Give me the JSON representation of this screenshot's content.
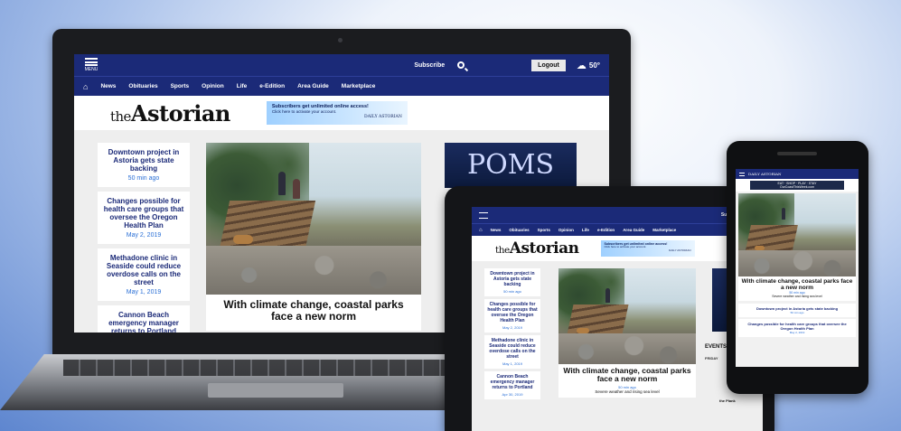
{
  "site": {
    "menu_label": "MENU",
    "subscribe": "Subscribe",
    "logout": "Logout",
    "weather_temp": "50°",
    "nav": [
      "News",
      "Obituaries",
      "Sports",
      "Opinion",
      "Life",
      "e-Edition",
      "Area Guide",
      "Marketplace"
    ],
    "logo_the": "the",
    "logo_name": "Astorian",
    "promo_line1": "Subscribers get unlimited online access!",
    "promo_line2": "Click here to activate your account.",
    "promo_brand": "DAILY ASTORIAN",
    "sidebar": [
      {
        "title": "Downtown project in Astoria gets state backing",
        "time": "50 min ago"
      },
      {
        "title": "Changes possible for health care groups that oversee the Oregon Health Plan",
        "time": "May 2, 2019"
      },
      {
        "title": "Methadone clinic in Seaside could reduce overdose calls on the street",
        "time": "May 1, 2019"
      },
      {
        "title": "Cannon Beach emergency manager returns to Portland",
        "time": "Apr 30, 2019"
      }
    ],
    "headline": "With climate change, coastal parks face a new norm",
    "headline_time": "50 min ago",
    "headline_sub": "Severe weather and rising sea level",
    "poms": "POMS",
    "events_label": "EVENTS",
    "friday": "FRIDAY",
    "phone_logo": "DAILY ASTORIAN",
    "phone_ad": "EAT · SHOP · PLAY · STAY",
    "phone_ad_sub": "OurCoastThisWeek.com",
    "tablet_side_text": "the Plank",
    "colors": {
      "nav_bg": "#1b2a78",
      "link_time": "#2a6fd6"
    }
  }
}
